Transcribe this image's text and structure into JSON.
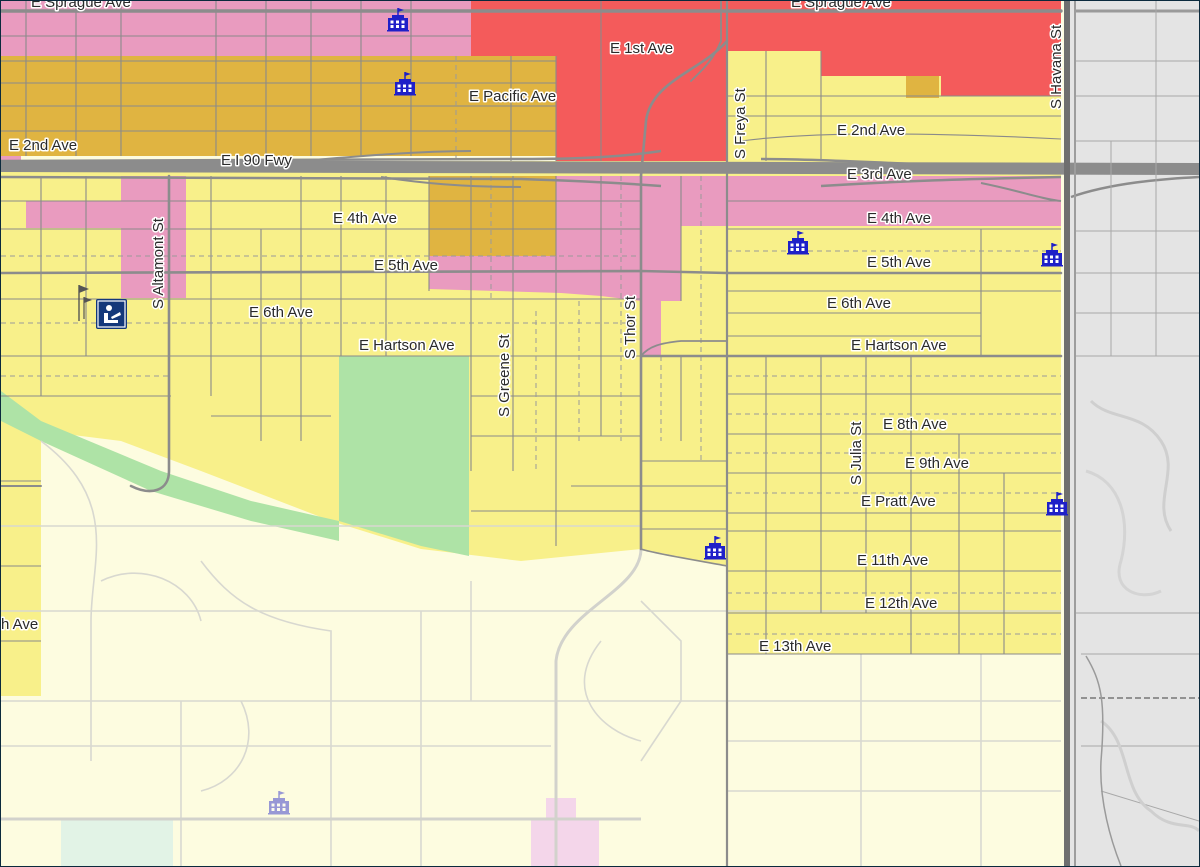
{
  "colors": {
    "background_gray": "#e4e4e4",
    "residential_yellow": "#f8f08a",
    "pale_yellow": "#fdfce0",
    "commercial_pink": "#e99bbf",
    "industrial_orange": "#e0b441",
    "commercial_red": "#f45b5b",
    "park_green": "#aee3a6",
    "road_gray": "#8a8a8a",
    "icon_blue": "#1f20c8"
  },
  "streets": {
    "e_sprague_ave_left": "E Sprague Ave",
    "e_sprague_ave_right": "E Sprague Ave",
    "e_1st_ave": "E 1st Ave",
    "e_pacific_ave": "E Pacific Ave",
    "e_2nd_ave_left": "E 2nd Ave",
    "e_2nd_ave_right": "E 2nd Ave",
    "e_i90_fwy": "E I 90 Fwy",
    "e_3rd_ave": "E 3rd Ave",
    "e_4th_ave_left": "E 4th Ave",
    "e_4th_ave_right": "E 4th Ave",
    "e_5th_ave_left": "E 5th Ave",
    "e_5th_ave_right": "E 5th Ave",
    "e_6th_ave_left": "E 6th Ave",
    "e_6th_ave_right": "E 6th Ave",
    "e_hartson_ave_left": "E Hartson Ave",
    "e_hartson_ave_right": "E Hartson Ave",
    "e_8th_ave": "E 8th Ave",
    "e_9th_ave": "E 9th Ave",
    "e_pratt_ave": "E Pratt Ave",
    "e_11th_ave": "E 11th Ave",
    "e_12th_ave": "E 12th Ave",
    "e_13th_ave": "E 13th Ave",
    "partial_ave": "h Ave",
    "s_altamont_st": "S Altamont St",
    "s_greene_st": "S Greene St",
    "s_thor_st": "S Thor St",
    "s_freya_st": "S Freya St",
    "s_julia_st": "S Julia St",
    "s_havana_st": "S Havana St"
  },
  "icons": {
    "school": "school-flag-icon",
    "library": "library-reading-icon",
    "flag": "flag-icon"
  }
}
